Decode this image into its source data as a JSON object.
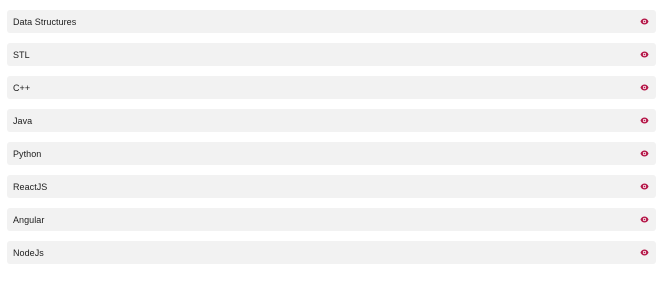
{
  "colors": {
    "row_background": "#f2f2f2",
    "icon_accent": "#b5194a",
    "text": "#1c1c1c"
  },
  "list": {
    "items": [
      {
        "label": "Data Structures",
        "icon": "eye-icon"
      },
      {
        "label": "STL",
        "icon": "eye-icon"
      },
      {
        "label": "C++",
        "icon": "eye-icon"
      },
      {
        "label": "Java",
        "icon": "eye-icon"
      },
      {
        "label": "Python",
        "icon": "eye-icon"
      },
      {
        "label": "ReactJS",
        "icon": "eye-icon"
      },
      {
        "label": "Angular",
        "icon": "eye-icon"
      },
      {
        "label": "NodeJs",
        "icon": "eye-icon"
      }
    ]
  }
}
